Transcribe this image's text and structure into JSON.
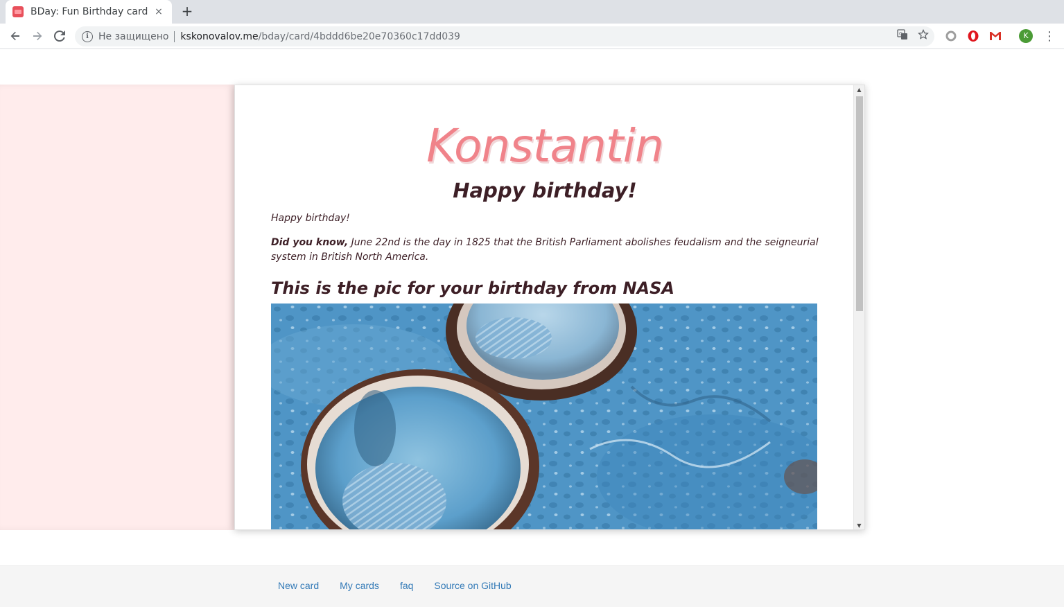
{
  "browser": {
    "tab_title": "BDay: Fun Birthday card",
    "tab_close": "×",
    "new_tab": "+",
    "security_label": "Не защищено",
    "url_host": "kskonovalov.me",
    "url_path": "/bday/card/4bddd6be20e70360c17dd039",
    "profile_initial": "K",
    "menu_glyph": "⋮"
  },
  "card": {
    "name": "Konstantin",
    "subtitle": "Happy birthday!",
    "greeting": "Happy birthday!",
    "fact_lead": "Did you know,",
    "fact_text": "June 22nd is the day in 1825 that the British Parliament abolishes feudalism and the seigneurial system in British North America.",
    "pic_heading": "This is the pic for your birthday from NASA"
  },
  "footer": {
    "links": [
      "New card",
      "My cards",
      "faq",
      "Source on GitHub"
    ]
  },
  "colors": {
    "accent_name": "#f0838a",
    "text_dark": "#3d1f26",
    "card_left_bg": "#ffecec",
    "link": "#337ab7"
  }
}
